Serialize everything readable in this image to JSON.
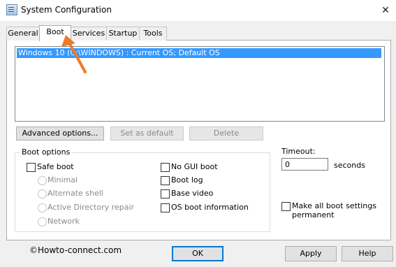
{
  "window": {
    "title": "System Configuration",
    "close_glyph": "✕"
  },
  "tabs": [
    {
      "label": "General"
    },
    {
      "label": "Boot"
    },
    {
      "label": "Services"
    },
    {
      "label": "Startup"
    },
    {
      "label": "Tools"
    }
  ],
  "os_list": {
    "selected_entry": "Windows 10 (C:\\WINDOWS) : Current OS; Default OS"
  },
  "list_buttons": {
    "advanced": "Advanced options...",
    "set_default": "Set as default",
    "delete": "Delete"
  },
  "boot_options": {
    "label": "Boot options",
    "safe_boot": "Safe boot",
    "minimal": "Minimal",
    "alternate_shell": "Alternate shell",
    "ad_repair": "Active Directory repair",
    "network": "Network",
    "no_gui": "No GUI boot",
    "boot_log": "Boot log",
    "base_video": "Base video",
    "os_boot_info": "OS boot information"
  },
  "timeout": {
    "label": "Timeout:",
    "value": "0",
    "unit": "seconds"
  },
  "permanent": {
    "line1": "Make all boot settings",
    "line2": "permanent"
  },
  "footer": {
    "watermark": "©Howto-connect.com",
    "ok": "OK",
    "apply": "Apply",
    "help": "Help"
  },
  "colors": {
    "selection": "#3399ff",
    "annotation_arrow": "#f07a28"
  }
}
